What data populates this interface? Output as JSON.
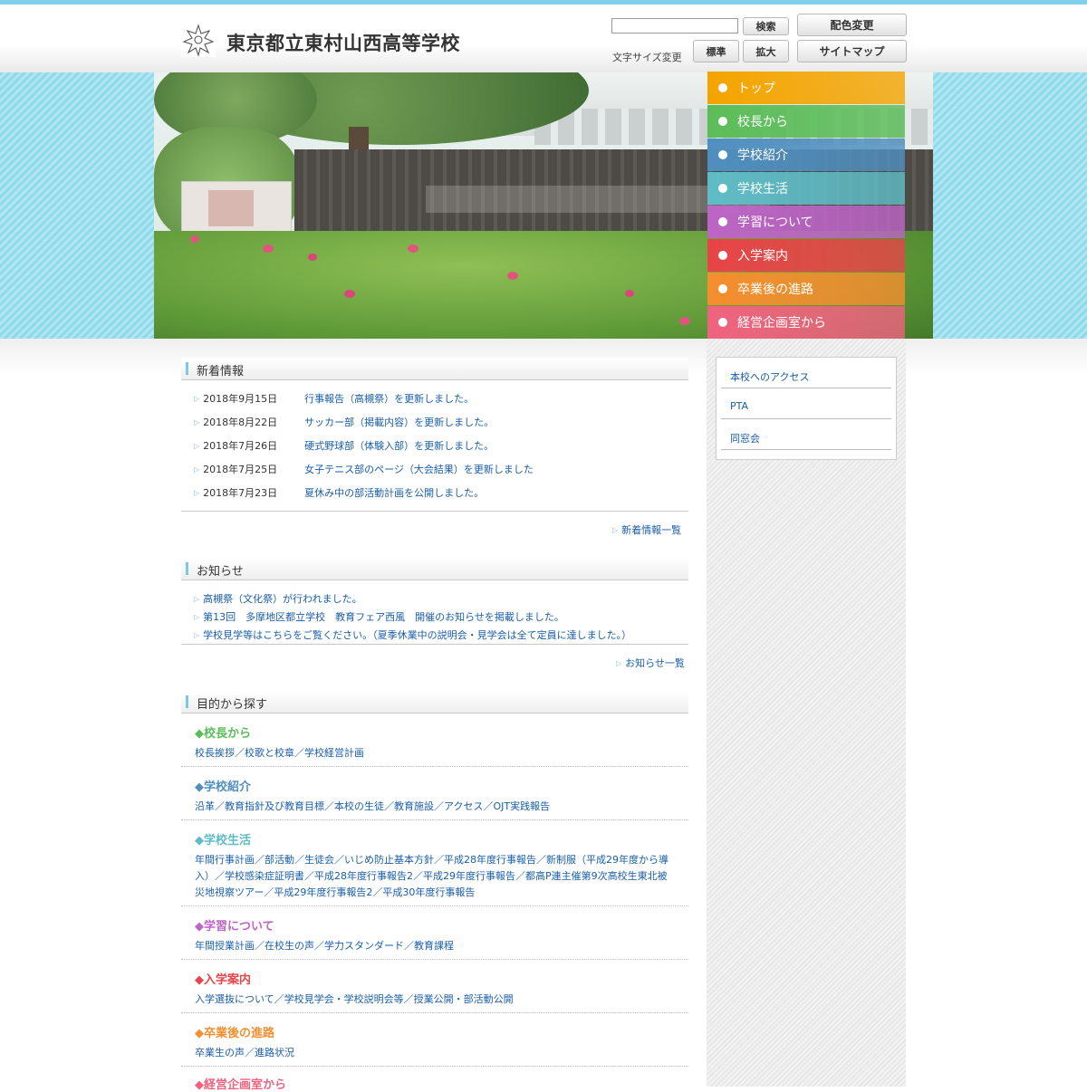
{
  "header": {
    "title": "東京都立東村山西高等学校",
    "logo_icon": "school-emblem-icon",
    "search_button": "検索",
    "color_button": "配色変更",
    "font_size_label": "文字サイズ変更",
    "font_standard": "標準",
    "font_large": "拡大",
    "sitemap_button": "サイトマップ"
  },
  "nav": [
    {
      "label": "トップ",
      "color": "#f4a400"
    },
    {
      "label": "校長から",
      "color": "#5bbd58"
    },
    {
      "label": "学校紹介",
      "color": "#4f8fbf"
    },
    {
      "label": "学校生活",
      "color": "#5fbcc6"
    },
    {
      "label": "学習について",
      "color": "#bd65c6"
    },
    {
      "label": "入学案内",
      "color": "#e84448"
    },
    {
      "label": "卒業後の進路",
      "color": "#f58e2f"
    },
    {
      "label": "経営企画室から",
      "color": "#f0637f"
    }
  ],
  "sidebar": {
    "links": [
      "本校へのアクセス",
      "PTA",
      "同窓会"
    ]
  },
  "news": {
    "heading": "新着情報",
    "items": [
      {
        "date": "2018年9月15日",
        "text": "行事報告（高槻祭）を更新しました。"
      },
      {
        "date": "2018年8月22日",
        "text": "サッカー部（掲載内容）を更新しました。"
      },
      {
        "date": "2018年7月26日",
        "text": "硬式野球部（体験入部）を更新しました。"
      },
      {
        "date": "2018年7月25日",
        "text": "女子テニス部のページ（大会結果）を更新しました"
      },
      {
        "date": "2018年7月23日",
        "text": "夏休み中の部活動計画を公開しました。"
      }
    ],
    "more": "新着情報一覧"
  },
  "notices": {
    "heading": "お知らせ",
    "items": [
      "高槻祭（文化祭）が行われました。",
      "第13回　多摩地区都立学校　教育フェア西風　開催のお知らせを掲載しました。",
      "学校見学等はこちらをご覧ください。（夏季休業中の説明会・見学会は全て定員に達しました。）"
    ],
    "more": "お知らせ一覧"
  },
  "purpose": {
    "heading": "目的から探す",
    "categories": [
      {
        "title": "◆校長から",
        "color": "#5bbd58",
        "links": "校長挨拶／校歌と校章／学校経営計画"
      },
      {
        "title": "◆学校紹介",
        "color": "#4f8fbf",
        "links": "沿革／教育指針及び教育目標／本校の生徒／教育施設／アクセス／OJT実践報告"
      },
      {
        "title": "◆学校生活",
        "color": "#5fbcc6",
        "links": "年間行事計画／部活動／生徒会／いじめ防止基本方針／平成28年度行事報告／新制服（平成29年度から導入）／学校感染症証明書／平成28年度行事報告2／平成29年度行事報告／都高P連主催第9次高校生東北被災地視察ツアー／平成29年度行事報告2／平成30年度行事報告"
      },
      {
        "title": "◆学習について",
        "color": "#bd65c6",
        "links": "年間授業計画／在校生の声／学力スタンダード／教育課程"
      },
      {
        "title": "◆入学案内",
        "color": "#e84448",
        "links": "入学選抜について／学校見学会・学校説明会等／授業公開・部活動公開"
      },
      {
        "title": "◆卒業後の進路",
        "color": "#f58e2f",
        "links": "卒業生の声／進路状況"
      },
      {
        "title": "◆経営企画室から",
        "color": "#f0637f",
        "links": ""
      }
    ]
  }
}
